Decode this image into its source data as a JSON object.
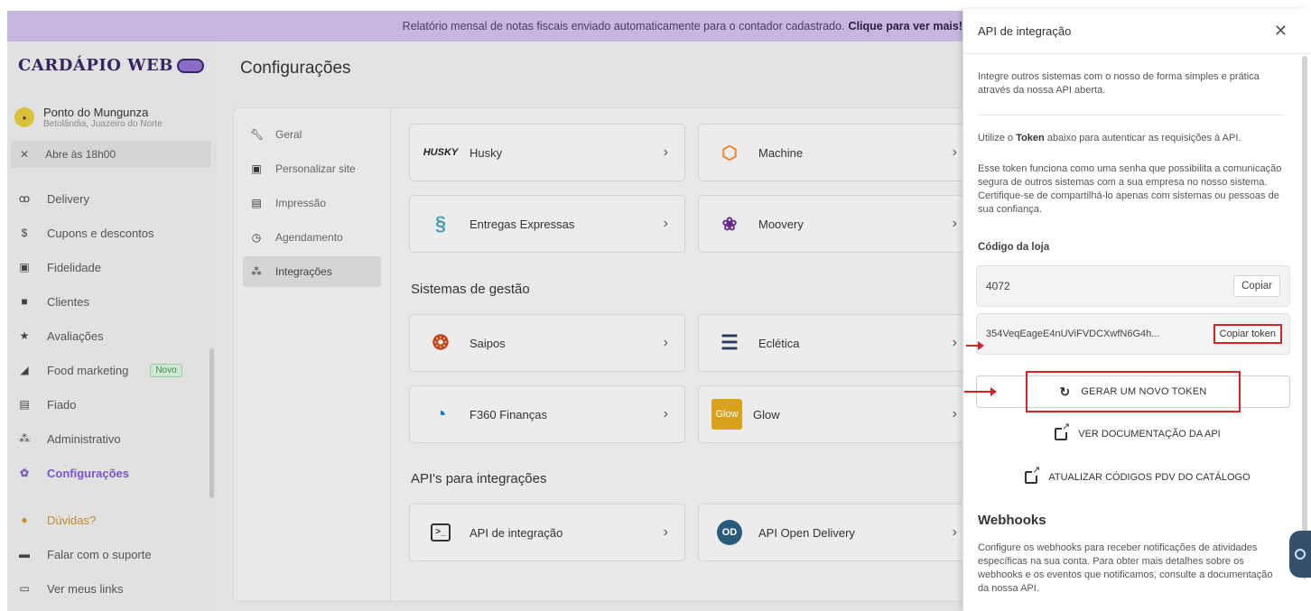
{
  "banner": {
    "text": "Relatório mensal de notas fiscais enviado automaticamente para o contador cadastrado.",
    "link": "Clique para ver mais!"
  },
  "sidebar": {
    "logo": "CARDÁPIO WEB",
    "store_name": "Ponto do Mungunza",
    "store_location": "Betolândia, Juazeiro do Norte",
    "store_avatar": "Mungunza",
    "open_status": "Abre às 18h00",
    "items": [
      {
        "label": "Delivery",
        "icon": "bike-icon"
      },
      {
        "label": "Cupons e descontos",
        "icon": "discount-icon"
      },
      {
        "label": "Fidelidade",
        "icon": "gift-icon"
      },
      {
        "label": "Clientes",
        "icon": "contacts-icon"
      },
      {
        "label": "Avaliações",
        "icon": "star-icon"
      },
      {
        "label": "Food marketing",
        "icon": "megaphone-icon",
        "badge": "Novo"
      },
      {
        "label": "Fiado",
        "icon": "book-icon"
      },
      {
        "label": "Administrativo",
        "icon": "users-icon"
      },
      {
        "label": "Configurações",
        "icon": "gear-icon",
        "active": true
      },
      {
        "label": "Dúvidas?",
        "icon": "help-icon"
      },
      {
        "label": "Falar com o suporte",
        "icon": "chat-icon"
      },
      {
        "label": "Ver meus links",
        "icon": "links-icon"
      }
    ]
  },
  "main": {
    "title": "Configurações",
    "subnav": [
      {
        "label": "Geral",
        "icon": "wrench-icon"
      },
      {
        "label": "Personalizar site",
        "icon": "layout-icon"
      },
      {
        "label": "Impressão",
        "icon": "printer-icon"
      },
      {
        "label": "Agendamento",
        "icon": "clock-icon"
      },
      {
        "label": "Integrações",
        "icon": "network-icon",
        "active": true
      }
    ],
    "delivery_tiles": [
      {
        "label": "Husky",
        "logo": "HUSKY"
      },
      {
        "label": "Machine",
        "logo": "machine-logo"
      },
      {
        "label": "Entregas Expressas",
        "logo": "entregas-logo"
      },
      {
        "label": "Moovery",
        "logo": "moovery-logo"
      }
    ],
    "section_gestao": "Sistemas de gestão",
    "gestao_tiles": [
      {
        "label": "Saipos",
        "logo": "saipos-logo"
      },
      {
        "label": "Eclética",
        "logo": "ecletica-logo"
      },
      {
        "label": "F360 Finanças",
        "logo": "f360-logo"
      },
      {
        "label": "Glow",
        "logo": "Glow"
      }
    ],
    "section_apis": "API's para integrações",
    "api_tiles": [
      {
        "label": "API de integração",
        "logo": "terminal-icon"
      },
      {
        "label": "API Open Delivery",
        "logo": "OD"
      }
    ]
  },
  "panel": {
    "title": "API de integração",
    "intro": "Integre outros sistemas com o nosso de forma simples e prática através da nossa API aberta.",
    "token_hint_pre": "Utilize o ",
    "token_hint_bold": "Token",
    "token_hint_post": " abaixo para autenticar as requisições à API.",
    "token_desc": "Esse token funciona como uma senha que possibilita a comunicação segura de outros sistemas com a sua empresa no nosso sistema. Certifique-se de compartilhá-lo apenas com sistemas ou pessoas de sua confiança.",
    "store_code_label": "Código da loja",
    "store_code": "4072",
    "copy_label": "Copiar",
    "token_value": "354VeqEageE4nUViFVDCXwfN6G4h...",
    "copy_token_label": "Copiar token",
    "generate_label": "GERAR UM NOVO TOKEN",
    "docs_label": "VER DOCUMENTAÇÃO DA API",
    "update_codes_label": "ATUALIZAR CÓDIGOS PDV DO CATÁLOGO",
    "webhooks_title": "Webhooks",
    "webhooks_desc": "Configure os webhooks para receber notificações de atividades específicas na sua conta. Para obter mais detalhes sobre os webhooks e os eventos que notificamos, consulte a documentação da nossa API."
  },
  "colors": {
    "banner": "#c7b6dd",
    "accent": "#7a55c9",
    "highlight": "#e01f1f"
  }
}
